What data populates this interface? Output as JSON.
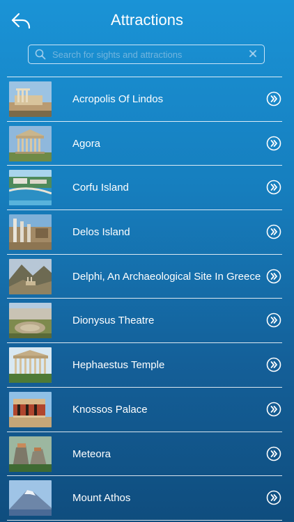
{
  "header": {
    "title": "Attractions",
    "back_icon": "back-arrow-icon"
  },
  "search": {
    "placeholder": "Search for sights and attractions",
    "value": "",
    "search_icon": "search-icon",
    "clear_icon": "clear-icon"
  },
  "attractions": [
    {
      "name": "Acropolis Of Lindos",
      "thumb_icon": "acropolis-lindos-photo"
    },
    {
      "name": "Agora",
      "thumb_icon": "agora-photo"
    },
    {
      "name": "Corfu Island",
      "thumb_icon": "corfu-island-photo"
    },
    {
      "name": "Delos Island",
      "thumb_icon": "delos-island-photo"
    },
    {
      "name": "Delphi, An Archaeological Site In Greece",
      "thumb_icon": "delphi-photo"
    },
    {
      "name": "Dionysus Theatre",
      "thumb_icon": "dionysus-theatre-photo"
    },
    {
      "name": "Hephaestus Temple",
      "thumb_icon": "hephaestus-temple-photo"
    },
    {
      "name": "Knossos Palace",
      "thumb_icon": "knossos-palace-photo"
    },
    {
      "name": "Meteora",
      "thumb_icon": "meteora-photo"
    },
    {
      "name": "Mount Athos",
      "thumb_icon": "mount-athos-photo"
    }
  ],
  "row_action_icon": "double-chevron-right-circle-icon",
  "colors": {
    "background_top": "#1a93d6",
    "background_bottom": "#0f4d7e",
    "text": "#ffffff",
    "divider": "#ffffff"
  }
}
